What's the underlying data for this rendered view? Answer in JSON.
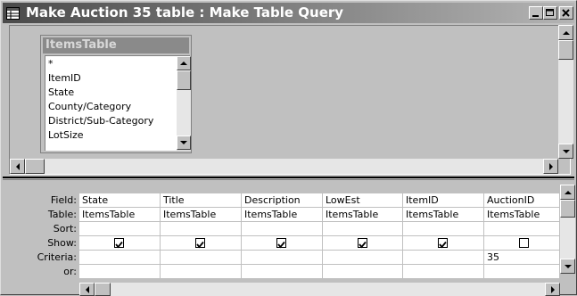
{
  "window": {
    "title": "Make Auction 35 table : Make Table Query",
    "icon": "query-icon",
    "buttons": [
      "minimize-icon",
      "maximize-icon",
      "close-icon"
    ]
  },
  "field_list": {
    "title": "ItemsTable",
    "items": [
      "*",
      "ItemID",
      "State",
      "County/Category",
      "District/Sub-Category",
      "LotSize"
    ]
  },
  "grid": {
    "row_labels": [
      "Field:",
      "Table:",
      "Sort:",
      "Show:",
      "Criteria:",
      "or:"
    ],
    "columns": [
      {
        "field": "State",
        "table": "ItemsTable",
        "sort": "",
        "show": true,
        "criteria": "",
        "or": ""
      },
      {
        "field": "Title",
        "table": "ItemsTable",
        "sort": "",
        "show": true,
        "criteria": "",
        "or": ""
      },
      {
        "field": "Description",
        "table": "ItemsTable",
        "sort": "",
        "show": true,
        "criteria": "",
        "or": ""
      },
      {
        "field": "LowEst",
        "table": "ItemsTable",
        "sort": "",
        "show": true,
        "criteria": "",
        "or": ""
      },
      {
        "field": "ItemID",
        "table": "ItemsTable",
        "sort": "",
        "show": true,
        "criteria": "",
        "or": ""
      },
      {
        "field": "AuctionID",
        "table": "ItemsTable",
        "sort": "",
        "show": false,
        "criteria": "35",
        "or": ""
      }
    ]
  }
}
